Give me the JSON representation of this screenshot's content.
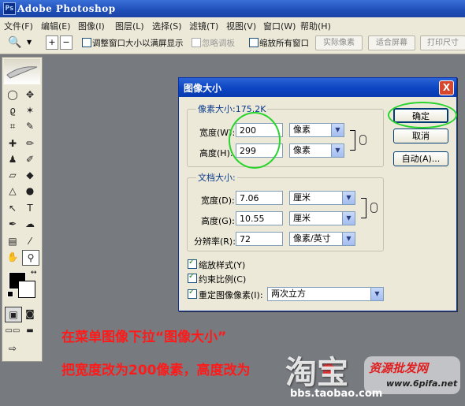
{
  "app_title": "Adobe Photoshop",
  "menu": [
    "文件(F)",
    "编辑(E)",
    "图像(I)",
    "图层(L)",
    "选择(S)",
    "滤镜(T)",
    "视图(V)",
    "窗口(W)",
    "帮助(H)"
  ],
  "options": {
    "fit_window_label": "调整窗口大小以满屏显示",
    "ignore_palettes_label": "忽略调板",
    "zoom_all_label": "缩放所有窗口",
    "actual_pixels": "实际像素",
    "fit_screen": "适合屏幕",
    "print_size": "打印尺寸"
  },
  "dialog": {
    "title": "图像大小",
    "close": "X",
    "pixel_dims_label": "像素大小:175.2K",
    "width_label": "宽度(W):",
    "width_value": "200",
    "width_unit": "像素",
    "height_label": "高度(H):",
    "height_value": "299",
    "height_unit": "像素",
    "doc_size_label": "文档大小:",
    "doc_width_label": "宽度(D):",
    "doc_width_value": "7.06",
    "doc_width_unit": "厘米",
    "doc_height_label": "高度(G):",
    "doc_height_value": "10.55",
    "doc_height_unit": "厘米",
    "resolution_label": "分辨率(R):",
    "resolution_value": "72",
    "resolution_unit": "像素/英寸",
    "scale_styles": "缩放样式(Y)",
    "constrain": "约束比例(C)",
    "resample": "重定图像像素(I):",
    "resample_method": "两次立方",
    "ok": "确定",
    "cancel": "取消",
    "auto": "自动(A)..."
  },
  "annotation": {
    "line1": "在菜单图像下拉“图像大小”",
    "line2": "把宽度改为200像素，高度改为",
    "line2_partial": "像",
    "watermark": "淘宝",
    "watermark_url": "bbs.taobao.com",
    "watermark2": "资源批发网",
    "watermark2_url": "www.6pifa.net"
  },
  "colors": {
    "accent_circle": "#29d42d",
    "annotation": "#ff1a1a"
  }
}
